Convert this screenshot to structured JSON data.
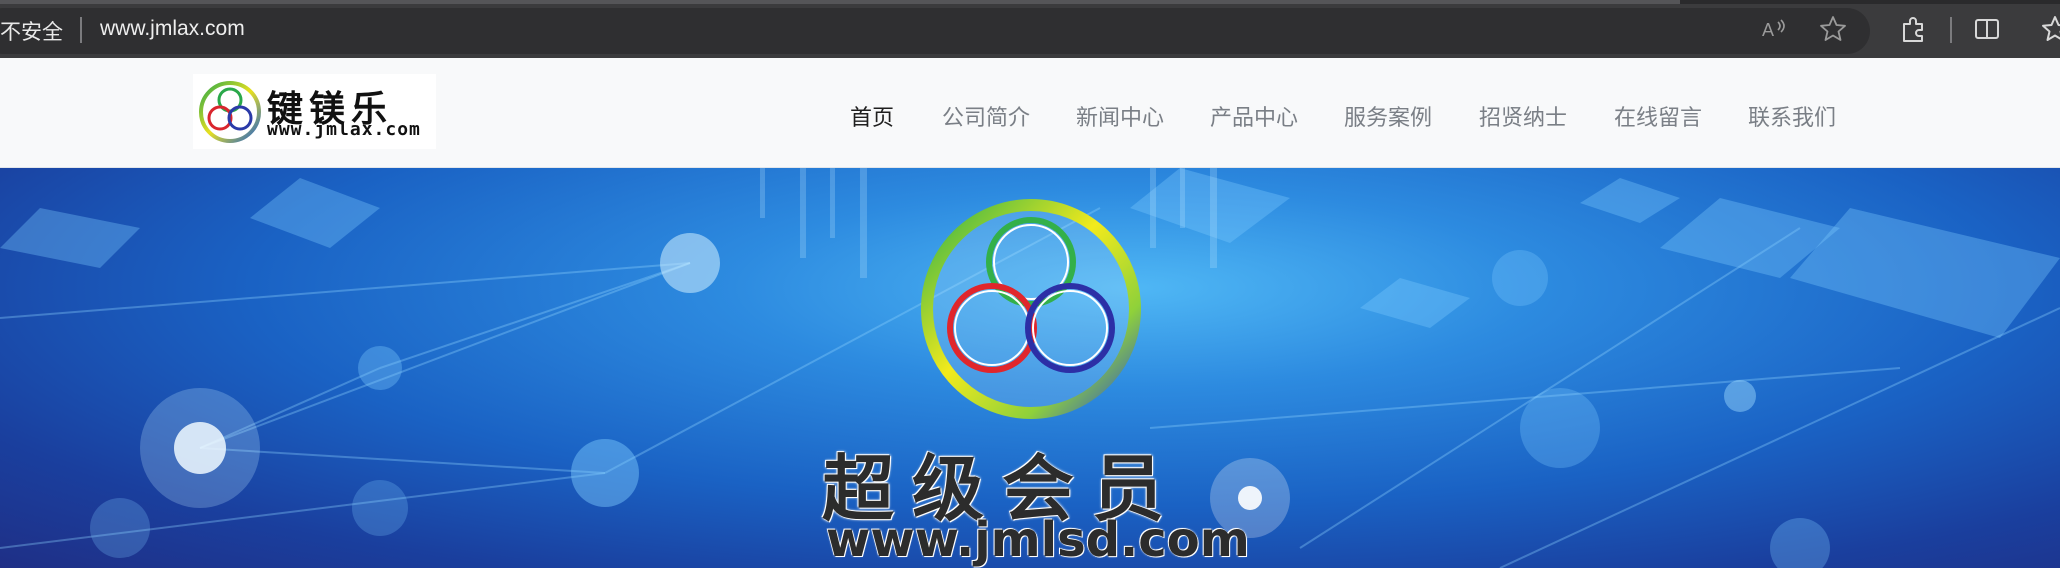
{
  "browser": {
    "security_label": "不安全",
    "url": "www.jmlax.com"
  },
  "header": {
    "logo_text_cn": "键镁乐",
    "logo_text_en": "www.jmlax.com",
    "nav": [
      {
        "label": "首页",
        "active": true
      },
      {
        "label": "公司简介",
        "active": false
      },
      {
        "label": "新闻中心",
        "active": false
      },
      {
        "label": "产品中心",
        "active": false
      },
      {
        "label": "服务案例",
        "active": false
      },
      {
        "label": "招贤纳士",
        "active": false
      },
      {
        "label": "在线留言",
        "active": false
      },
      {
        "label": "联系我们",
        "active": false
      }
    ]
  },
  "banner": {
    "title": "超级会员",
    "url": "www.jmlsd.com"
  },
  "colors": {
    "chrome_bg": "#3b3b3d",
    "header_bg": "#f8f9fa",
    "nav_active": "#1f1f1f",
    "nav_inactive": "#7a7f86",
    "banner_blue": "#1a62c4"
  }
}
